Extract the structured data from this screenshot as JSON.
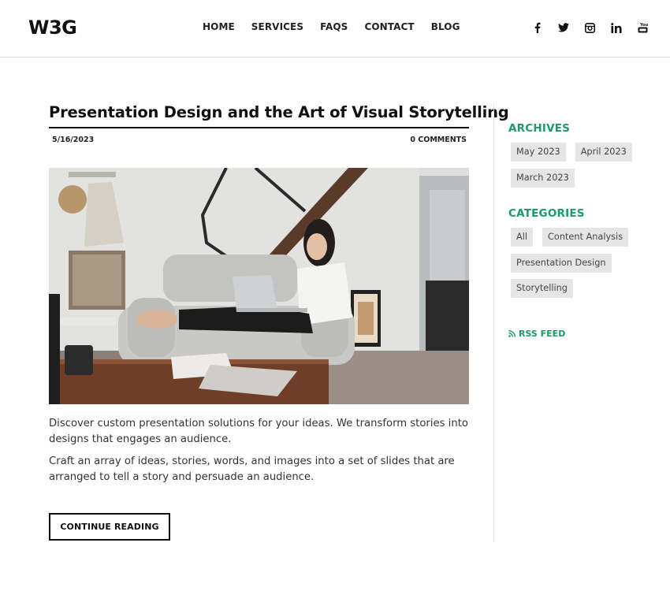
{
  "header": {
    "logo": "W3G",
    "nav": [
      {
        "label": "HOME"
      },
      {
        "label": "SERVICES"
      },
      {
        "label": "FAQS"
      },
      {
        "label": "CONTACT"
      },
      {
        "label": "BLOG"
      }
    ],
    "social_icons": [
      "facebook-icon",
      "twitter-icon",
      "instagram-icon",
      "linkedin-icon",
      "youtube-icon"
    ]
  },
  "post": {
    "title": "Presentation Design and the Art of Visual Storytelling",
    "date": "5/16/2023",
    "comments": "0 COMMENTS",
    "image_alt": "Woman with glasses working on a laptop on a grey sofa in a living room",
    "paragraphs": [
      "Discover custom presentation solutions for your ideas. We transform stories into designs that engages an audience.",
      "Craft an array of ideas, stories, words, and images into a set of slides that are arranged to tell a story and persuade an audience."
    ],
    "continue_label": "CONTINUE READING"
  },
  "sidebar": {
    "archives_heading": "ARCHIVES",
    "archives": [
      "May 2023",
      "April 2023",
      "March 2023"
    ],
    "categories_heading": "CATEGORIES",
    "categories": [
      "All",
      "Content Analysis",
      "Presentation Design",
      "Storytelling"
    ],
    "rss_label": "RSS FEED"
  },
  "colors": {
    "accent": "#1a9a66",
    "text": "#111111",
    "tag_bg": "#e6e6e6"
  }
}
